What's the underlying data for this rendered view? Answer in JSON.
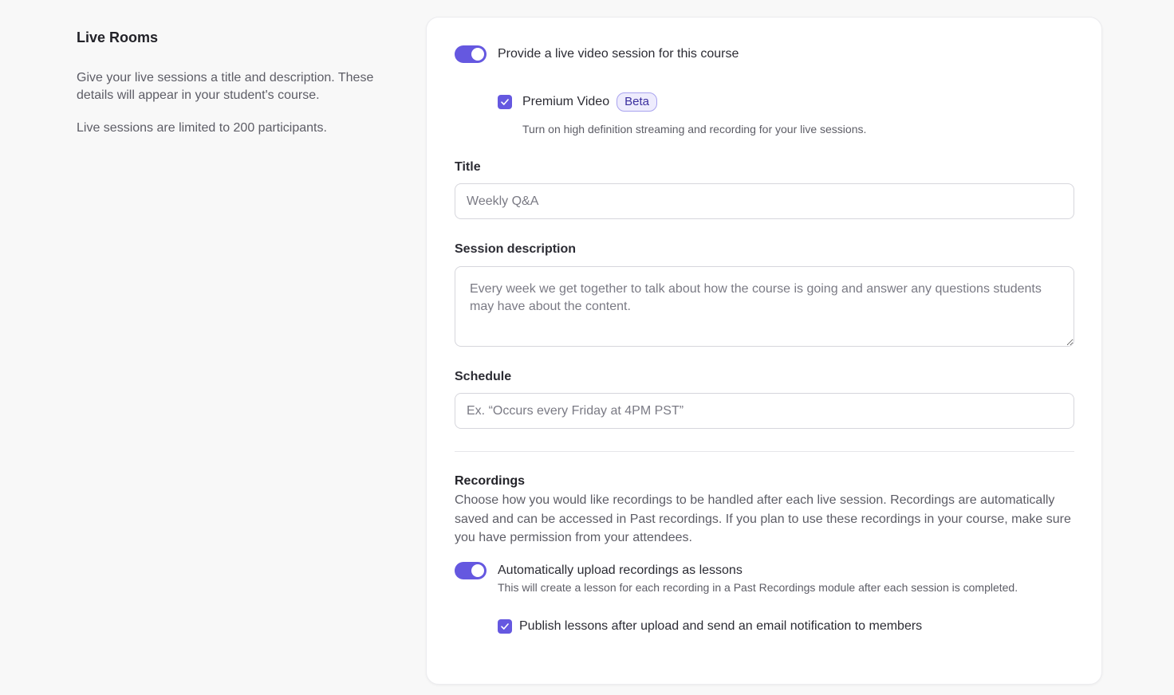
{
  "sidebar": {
    "title": "Live Rooms",
    "description": "Give your live sessions a title and description. These details will appear in your student's course.",
    "limit_note": "Live sessions are limited to 200 participants."
  },
  "live_session": {
    "toggle_on": true,
    "label": "Provide a live video session for this course"
  },
  "premium_video": {
    "checked": true,
    "label": "Premium Video",
    "badge": "Beta",
    "hint": "Turn on high definition streaming and recording for your live sessions."
  },
  "title_field": {
    "label": "Title",
    "placeholder": "Weekly Q&A"
  },
  "description_field": {
    "label": "Session description",
    "placeholder": "Every week we get together to talk about how the course is going and answer any questions students may have about the content."
  },
  "schedule_field": {
    "label": "Schedule",
    "placeholder": "Ex. “Occurs every Friday at 4PM PST”"
  },
  "recordings": {
    "title": "Recordings",
    "description": "Choose how you would like recordings to be handled after each live session. Recordings are automatically saved and can be accessed in Past recordings. If you plan to use these recordings in your course, make sure you have permission from your attendees.",
    "auto_upload": {
      "toggle_on": true,
      "label": "Automatically upload recordings as lessons",
      "hint": "This will create a lesson for each recording in a Past Recordings module after each session is completed."
    },
    "publish": {
      "checked": true,
      "label": "Publish lessons after upload and send an email notification to members"
    }
  },
  "colors": {
    "accent": "#6558e0",
    "page_background": "#f8f8f8",
    "card_background": "#ffffff",
    "badge_background": "#eeecfd",
    "badge_text": "#3b2f9e"
  }
}
